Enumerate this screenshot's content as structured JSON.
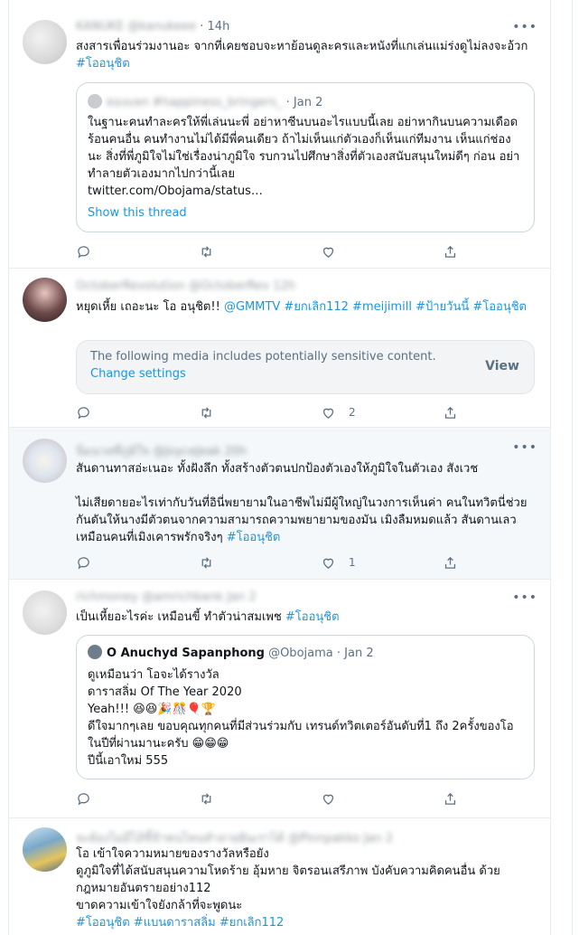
{
  "tweets": [
    {
      "author_name": "KANUKE",
      "time": "14h",
      "text": "สงสารเพื่อนร่วมงานอะ จากที่เคยชอบจะหาย้อนดูละครและหนังที่แกเล่นแม่ร่งดูไม่ลงจะอ้วก ",
      "hashtags": [
        "#โออนุชิต"
      ],
      "quote": {
        "author": "ตองแพร #happiness_bringers_",
        "date": "Jan 2",
        "text": "ในฐานะคนทำละครให้พี่เล่นนะพี่ อย่าหาซีนบนอะไรแบบนี้เลย อย่าหากินบนความเดือดร้อนคนอื่น คนทำงานไม่ได้มีพี่คนเดียว ถ้าไม่เห็นแก่ตัวเองก็เห็นแก่ทีมงาน เห็นแก่ช่องนะ สิ่งที่พี่ภูมิใจไม่ใช่เรื่องน่าภูมิใจ รบกวนไปศึกษาสิ่งที่ตัวเองสนับสนุนใหม่ดีๆ ก่อน อย่าทำลายตัวเองมากไปกว่านี้เลย",
        "link": "twitter.com/Obojama/status…",
        "thread_label": "Show this thread"
      },
      "likes": ""
    },
    {
      "author_name": "OctoberRevolution",
      "time": "12h",
      "text": "หยุดเหี้ย เถอะนะ โอ อนุชิต!! ",
      "mentions": [
        "@GMMTV"
      ],
      "hashtags": [
        "#ยกเลิก112",
        "#meijimill",
        "#ป้ายวันนี้",
        "#โออนุชิต"
      ],
      "notice": {
        "text": "The following media includes potentially sensitive content.",
        "change": "Change settings",
        "view": "View"
      },
      "likes": "2"
    },
    {
      "author_name": "นิ่มนวลที่ภูมิใจ",
      "handle": "@JoyceJeak",
      "time": "20h",
      "text": "สันดานทาสอ่ะเนอะ ทั้งฝังลึก ทั้งสร้างตัวตนปกป้องตัวเองให้ภูมิใจในตัวเอง สังเวช\n\nไม่เสียดายอะไรเท่ากับวันที่อินี่พยายามในอาชีพไม่มีผู้ใหญ่ในวงการเห็นค่า คนในทวิตนี่ช่วยกันดันให้นางมีตัวตนจากความสามารถความพยายามของมัน เมิงลืมหมดแล้ว สันดานเลวเหมือนคนที่เมิงเคารพรักจริงๆ ",
      "hashtags": [
        "#โออนุชิต"
      ],
      "likes": "1"
    },
    {
      "author_name": "richmoney",
      "handle": "@amrichbank",
      "time": "Jan 2",
      "text": "เป็นเหี้ยอะไรค่ะ เหมือนขี้ ทำตัวน่าสมเพช ",
      "hashtags": [
        "#โออนุชิต"
      ],
      "quote": {
        "author": "O Anuchyd Sapanphong",
        "handle": "@Obojama",
        "date": "Jan 2",
        "text": "ดูเหมือนว่า โอจะได้รางวัล\nดาราสลิ่ม Of The Year 2020\nYeah!!! 😆😆🎉🎊🎈🏆\nดีใจมากๆเลย ขอบคุณทุกคนที่มีส่วนร่วมกับ เทรนด์ทวิตเตอร์อันดับที่1 ถึง 2ครั้งของโอในปีที่ผ่านมานะครับ 😁😁😁\nปีนี้เอาใหม่ 555"
      },
      "likes": ""
    },
    {
      "author_name": "จะต้องไม่มีไอ้ขี้ข้าคนไหนทำลายฝันเราได้",
      "handle": "@Pinnpakko",
      "time": "Jan 2",
      "text": "โอ เข้าใจความหมายของรางวัลหรือยัง\nดูภูมิใจที่ได้สนับสนุนความโหดร้าย อุ้มหาย จิตรอนเสรีภาพ บังคับความคิดคนอื่น ด้วยกฎหมายอันตรายอย่าง112\nขาดความเข้าใจยังกล้าที่จะพูดนะ\n",
      "hashtags": [
        "#โออนุชิต",
        "#แบนดาราสลิ่ม",
        "#ยกเลิก112"
      ]
    }
  ],
  "icons": [
    "reply-icon",
    "retweet-icon",
    "like-icon",
    "share-icon",
    "more-icon"
  ],
  "colors": {
    "link": "#1b95e0",
    "muted": "#5b7083",
    "border": "#e6ecf0",
    "shaded": "#f5f8fa"
  }
}
